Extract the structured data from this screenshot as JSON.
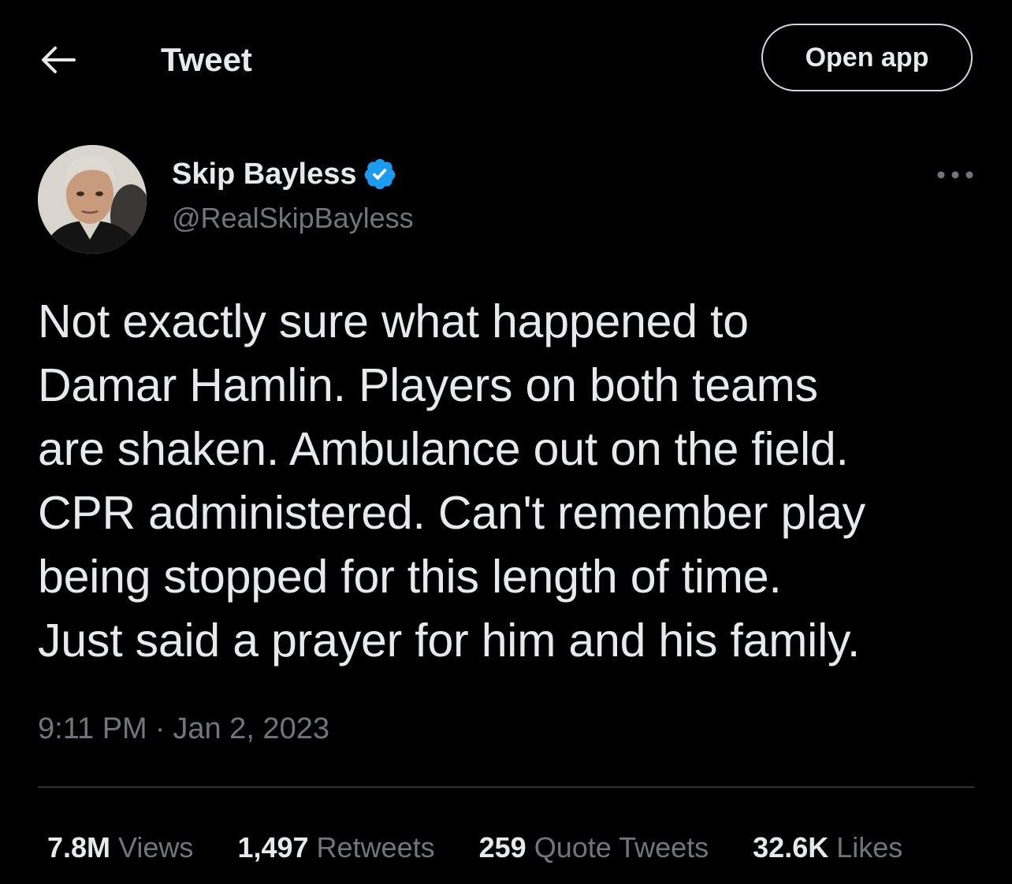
{
  "header": {
    "back_icon": "back-arrow-icon",
    "title": "Tweet",
    "open_app_label": "Open app"
  },
  "author": {
    "name": "Skip Bayless",
    "handle": "@RealSkipBayless",
    "verified_icon": "verified-badge-icon",
    "verified_color": "#1d9bf0",
    "more_icon": "more-options-icon"
  },
  "tweet": {
    "text": "Not exactly sure what happened to\nDamar Hamlin. Players on both teams\nare shaken. Ambulance out on the field.\nCPR administered. Can't remember play\nbeing stopped for this length of time.\nJust said a prayer for him and his family.",
    "time": "9:11 PM",
    "separator": "·",
    "date": "Jan 2, 2023"
  },
  "stats": [
    {
      "value": "7.8M",
      "label": "Views"
    },
    {
      "value": "1,497",
      "label": "Retweets"
    },
    {
      "value": "259",
      "label": "Quote Tweets"
    },
    {
      "value": "32.6K",
      "label": "Likes"
    }
  ],
  "colors": {
    "background": "#000000",
    "primary_text": "#e7e9ea",
    "secondary_text": "#71767b",
    "divider": "#2f3336",
    "accent": "#1d9bf0"
  }
}
